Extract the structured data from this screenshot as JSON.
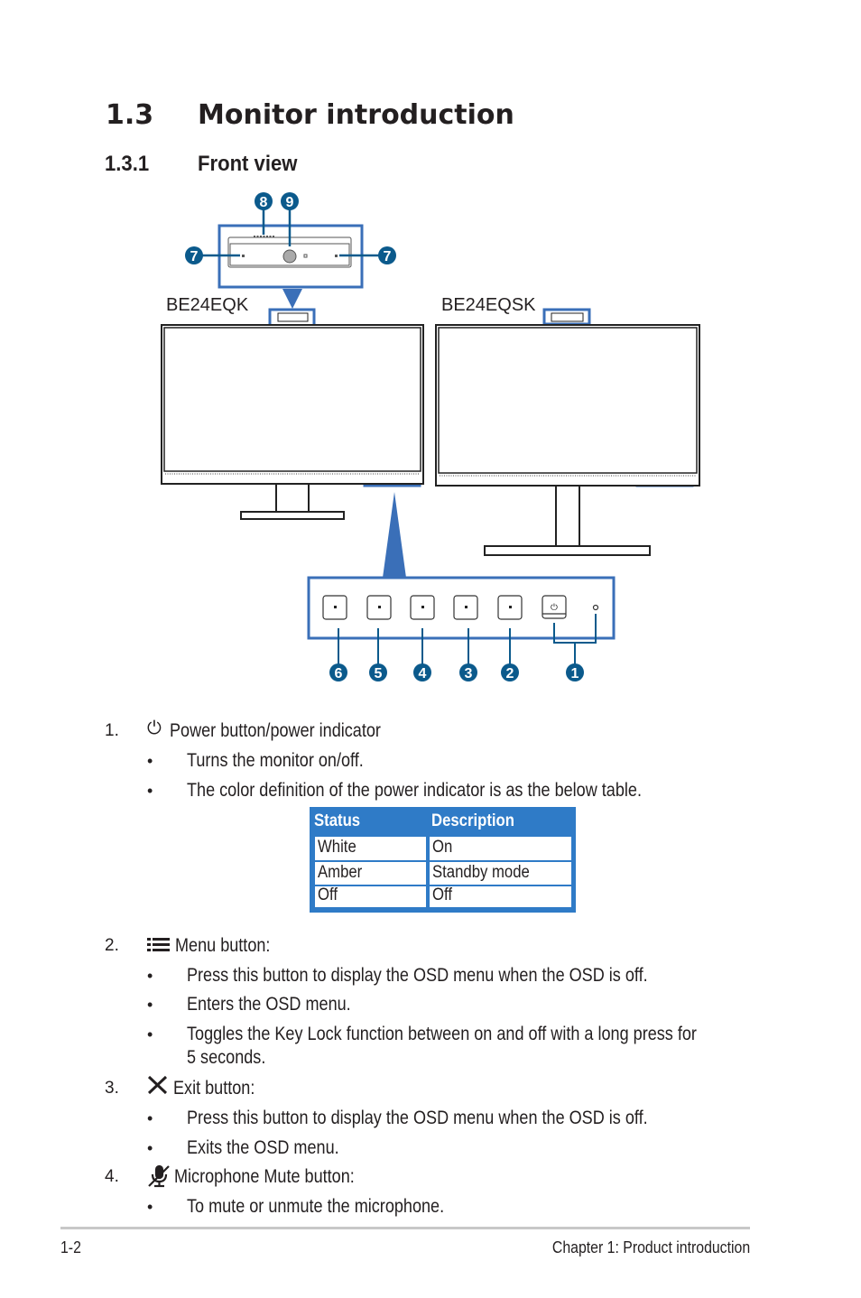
{
  "heading": {
    "number": "1.3",
    "title": "Monitor introduction"
  },
  "subheading": {
    "number": "1.3.1",
    "title": "Front view"
  },
  "diagram": {
    "models": [
      "BE24EQK",
      "BE24EQSK"
    ],
    "top_callouts": [
      "8",
      "9",
      "7",
      "7"
    ],
    "button_callouts": [
      "6",
      "5",
      "4",
      "3",
      "2",
      "1"
    ],
    "accent_color": "#3a6fb8",
    "badge_color": "#0b5a8c"
  },
  "items": [
    {
      "number": "1.",
      "icon": "power-icon",
      "title": "Power button/power indicator",
      "bullets": [
        "Turns the monitor on/off.",
        "The color definition of the power indicator is as the below table."
      ]
    },
    {
      "number": "2.",
      "icon": "menu-icon",
      "title": "Menu button:",
      "bullets": [
        "Press this button to display the OSD menu when the OSD is off.",
        "Enters the OSD menu.",
        "Toggles the Key Lock function between on and off with a long press for",
        "5 seconds."
      ]
    },
    {
      "number": "3.",
      "icon": "close-icon",
      "title": "Exit button:",
      "bullets": [
        "Press this button to display the OSD menu when the OSD is off.",
        "Exits the OSD menu."
      ]
    },
    {
      "number": "4.",
      "icon": "microphone-mute-icon",
      "title": "Microphone Mute button:",
      "bullets": [
        "To mute or unmute the microphone."
      ]
    }
  ],
  "table": {
    "headers": [
      "Status",
      "Description"
    ],
    "rows": [
      [
        "White",
        "On"
      ],
      [
        "Amber",
        "Standby mode"
      ],
      [
        "Off",
        "Off"
      ]
    ],
    "header_color": "#2f7bc7"
  },
  "footer": {
    "page": "1-2",
    "chapter": "Chapter 1: Product introduction"
  }
}
